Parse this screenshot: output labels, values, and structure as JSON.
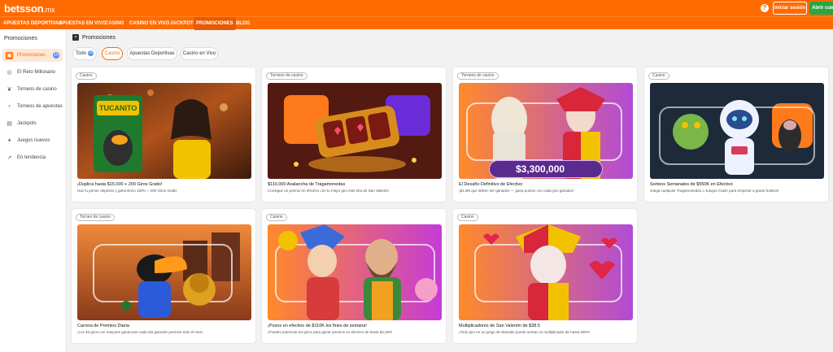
{
  "header": {
    "logo": "betsson",
    "logo_tld": ".mx",
    "help_icon": "help-icon",
    "login_label": "Iniciar sesión",
    "register_label": "Abrir cuenta"
  },
  "nav": {
    "items": [
      {
        "label": "APUESTAS DEPORTIVAS"
      },
      {
        "label": "APUESTAS EN VIVO"
      },
      {
        "label": "CASINO"
      },
      {
        "label": "CASINO EN VIVO"
      },
      {
        "label": "JACKPOT"
      },
      {
        "label": "PROMOCIONES"
      },
      {
        "label": "BLOG"
      }
    ],
    "active": "PROMOCIONES"
  },
  "sidebar": {
    "title": "Promociones",
    "items": [
      {
        "label": "Promociones",
        "icon": "gift-icon",
        "badge": "15"
      },
      {
        "label": "El Reto Millonario",
        "icon": "medal-icon"
      },
      {
        "label": "Torneos de casino",
        "icon": "laurel-icon"
      },
      {
        "label": "Torneos de apuestas",
        "icon": "trophy-icon"
      },
      {
        "label": "Jackpots",
        "icon": "jackpot-icon"
      },
      {
        "label": "Juegos nuevos",
        "icon": "sparkle-icon"
      },
      {
        "label": "En tendencia",
        "icon": "trending-icon"
      }
    ]
  },
  "main": {
    "title": "Promociones",
    "filters": [
      {
        "label": "Todo",
        "count": "15"
      },
      {
        "label": "Casino"
      },
      {
        "label": "Apuestas Deportivas"
      },
      {
        "label": "Casino en Vivo"
      }
    ],
    "active_filter": "Casino",
    "cards": [
      {
        "tag": "Casino",
        "title": "¡Duplica hasta $15,000 + 200 Giros Gratis!",
        "desc": "Haz tu primer depósito y gana Bono 100% + 200 Giros Gratis",
        "image_text": "TUCANITO"
      },
      {
        "tag": "Torneos de casino",
        "title": "$110,000 Avalancha de Tragamonedas",
        "desc": "Consigue un premio en efectivo con tu mejor giro este Día de San Valentín",
        "image_text": ""
      },
      {
        "tag": "Torneos de casino",
        "title": "El Desafío Definitivo de Efectivo",
        "desc": "¡$3.3M que deben ser ganados — gana puntos con cada giro ganador!",
        "image_text": "$3,300,000"
      },
      {
        "tag": "Casino",
        "title": "Sorteos Semanales de $550K en Efectivo",
        "desc": "Juega cualquier Tragamonedas o Juegos Crash para empezar a ganar boletos!",
        "image_text": ""
      },
      {
        "tag": "Torneo de casino",
        "title": "Carrera de Premios Diaria",
        "desc": "¡Los 40 giros con mayores ganancias cada día ganarán premios todo el mes!",
        "image_text": ""
      },
      {
        "tag": "Casino",
        "title": "¡Pozos en efectivo de $110K los fines de semana!",
        "desc": "¡Puedes potenciar tus giros para ganar premios en efectivo de hasta $2,200!",
        "image_text": ""
      },
      {
        "tag": "Casino",
        "title": "Multiplicadores de San Valentín de $38.5",
        "desc": "¡Todo giro en un juego de Wazdan puede activar un multiplicador de hasta 200X!",
        "image_text": ""
      }
    ]
  }
}
